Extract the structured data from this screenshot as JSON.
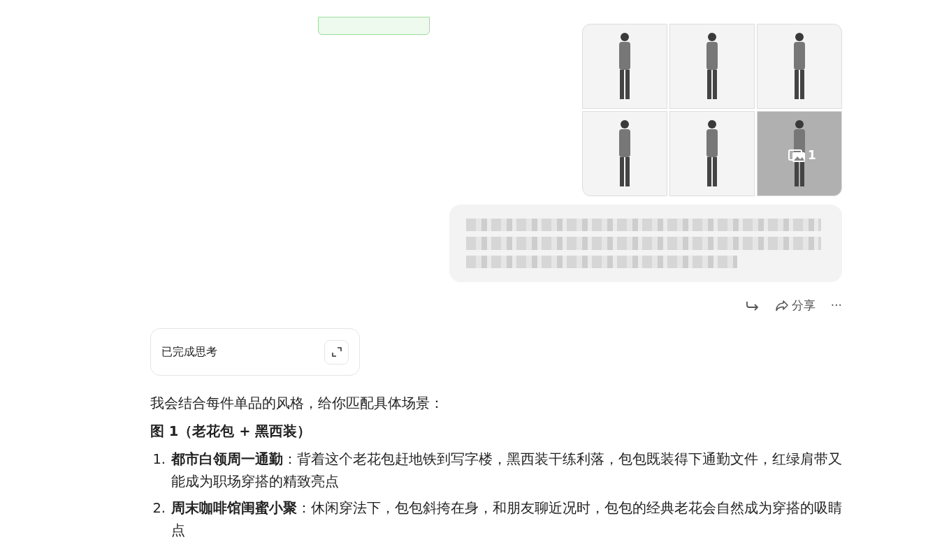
{
  "user_message": {
    "photos": [
      {
        "kind": "photo"
      },
      {
        "kind": "photo"
      },
      {
        "kind": "photo"
      },
      {
        "kind": "photo"
      },
      {
        "kind": "photo"
      },
      {
        "kind": "photo",
        "more_count": "1"
      }
    ],
    "blurred": true,
    "actions": [
      {
        "kind": "retry"
      },
      {
        "kind": "share",
        "label": "分享"
      },
      {
        "kind": "more",
        "label": "···"
      }
    ]
  },
  "reply": {
    "thinking": {
      "label": "已完成思考"
    },
    "intro": "我会结合每件单品的风格，给你匹配具体场景：",
    "heading": "图 1（老花包 + 黑西装）",
    "items": [
      {
        "number": "1.",
        "text": "**都市白领周一通勤**：背着这个老花包赶地铁到写字楼，黑西装干练利落，包包既装得下通勤文件，红绿肩带又能成为职场穿搭的精致亮点"
      },
      {
        "number": "2.",
        "text": "**周末咖啡馆闺蜜小聚**：休闲穿法下，包包斜挎在身，和朋友聊近况时，包包的经典老花会自然成为穿搭的吸睛点"
      }
    ]
  }
}
